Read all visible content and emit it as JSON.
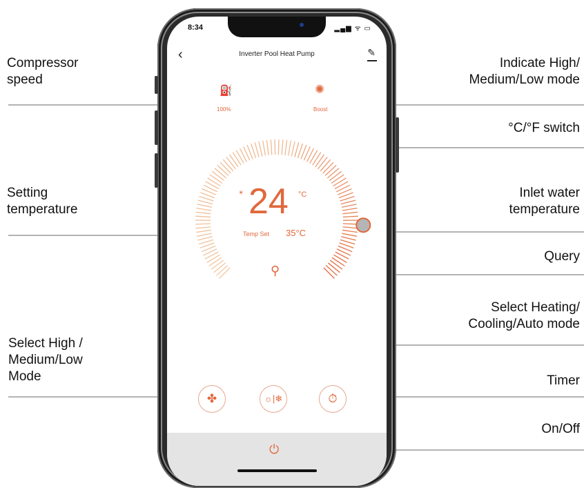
{
  "annotations": {
    "compressor_speed": "Compressor\nspeed",
    "indicate_mode": "Indicate High/\nMedium/Low mode",
    "unit_switch": "°C/°F switch",
    "setting_temperature": "Setting\ntemperature",
    "inlet_water_temperature": "Inlet water\ntemperature",
    "query": "Query",
    "select_heating_cooling": "Select Heating/\nCooling/Auto mode",
    "select_fan_mode": "Select High /\nMedium/Low\nMode",
    "timer": "Timer",
    "on_off": "On/Off"
  },
  "phone": {
    "status_time": "8:34",
    "status_icons": "▂▄▆ ᯤ ▭",
    "app_title": "Inverter Pool Heat Pump",
    "back_glyph": "‹",
    "edit_glyph": "✎",
    "compressor": {
      "icon": "compressor-icon",
      "glyph": "⛽",
      "label": "100%"
    },
    "fan_speed": {
      "icon": "fan-boost-icon",
      "glyph": "✺",
      "label": "Boost"
    },
    "set_temperature": "24",
    "temperature_unit": "°C",
    "mode_glyph": "☀",
    "temp_set_label": "Temp Set",
    "inlet_water_temp": "35°C",
    "query_glyph": "⚲",
    "buttons": {
      "fan": "✤",
      "mode": "☼|❄",
      "timer": "⏱"
    },
    "power_glyph": "⏻"
  },
  "colors": {
    "accent": "#e0683c",
    "dial_light": "#f3c7a0",
    "dial_dark": "#e0683c",
    "bottom_bar": "#e4e4e4"
  }
}
